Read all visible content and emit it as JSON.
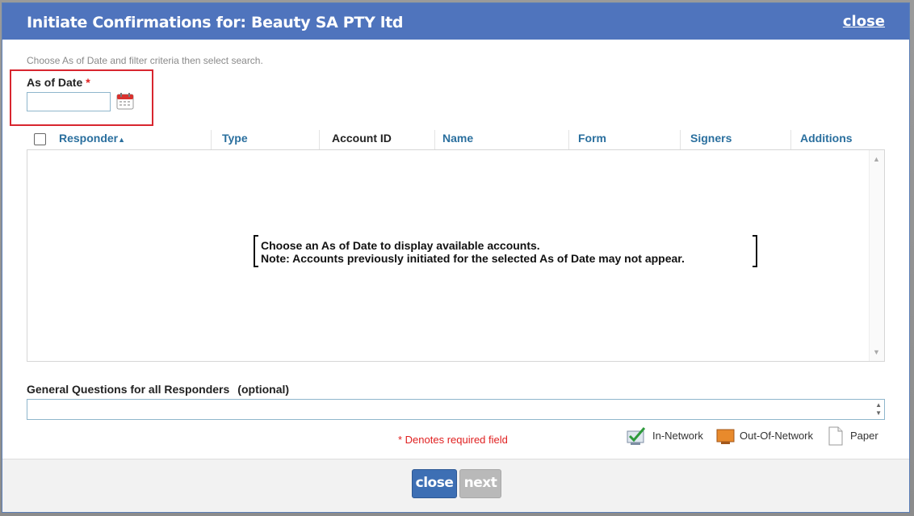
{
  "dialog": {
    "title": "Initiate Confirmations for: Beauty SA PTY ltd",
    "close_link": "close"
  },
  "hint": "Choose As of Date and filter criteria then select search.",
  "as_of_date": {
    "label": "As of Date",
    "required_marker": "*",
    "value": ""
  },
  "table": {
    "columns": [
      "Responder",
      "Type",
      "Account ID",
      "Name",
      "Form",
      "Signers",
      "Additions"
    ],
    "sort_indicator": "▲",
    "empty_message_line1": "Choose an As of Date to display available accounts.",
    "empty_message_line2": "Note: Accounts previously initiated for the selected As of Date may not appear."
  },
  "general_questions": {
    "label": "General Questions for all Responders",
    "optional": "(optional)",
    "value": ""
  },
  "required_note": "* Denotes required field",
  "legend": {
    "in_network": "In-Network",
    "out_of_network": "Out-Of-Network",
    "paper": "Paper"
  },
  "footer": {
    "close_label": "close",
    "next_label": "next"
  },
  "colors": {
    "title_bar": "#4f74bd",
    "link": "#2a6f9e",
    "required": "#e02020",
    "close_button": "#3d6fb4",
    "next_button_disabled": "#b9b9b9"
  }
}
